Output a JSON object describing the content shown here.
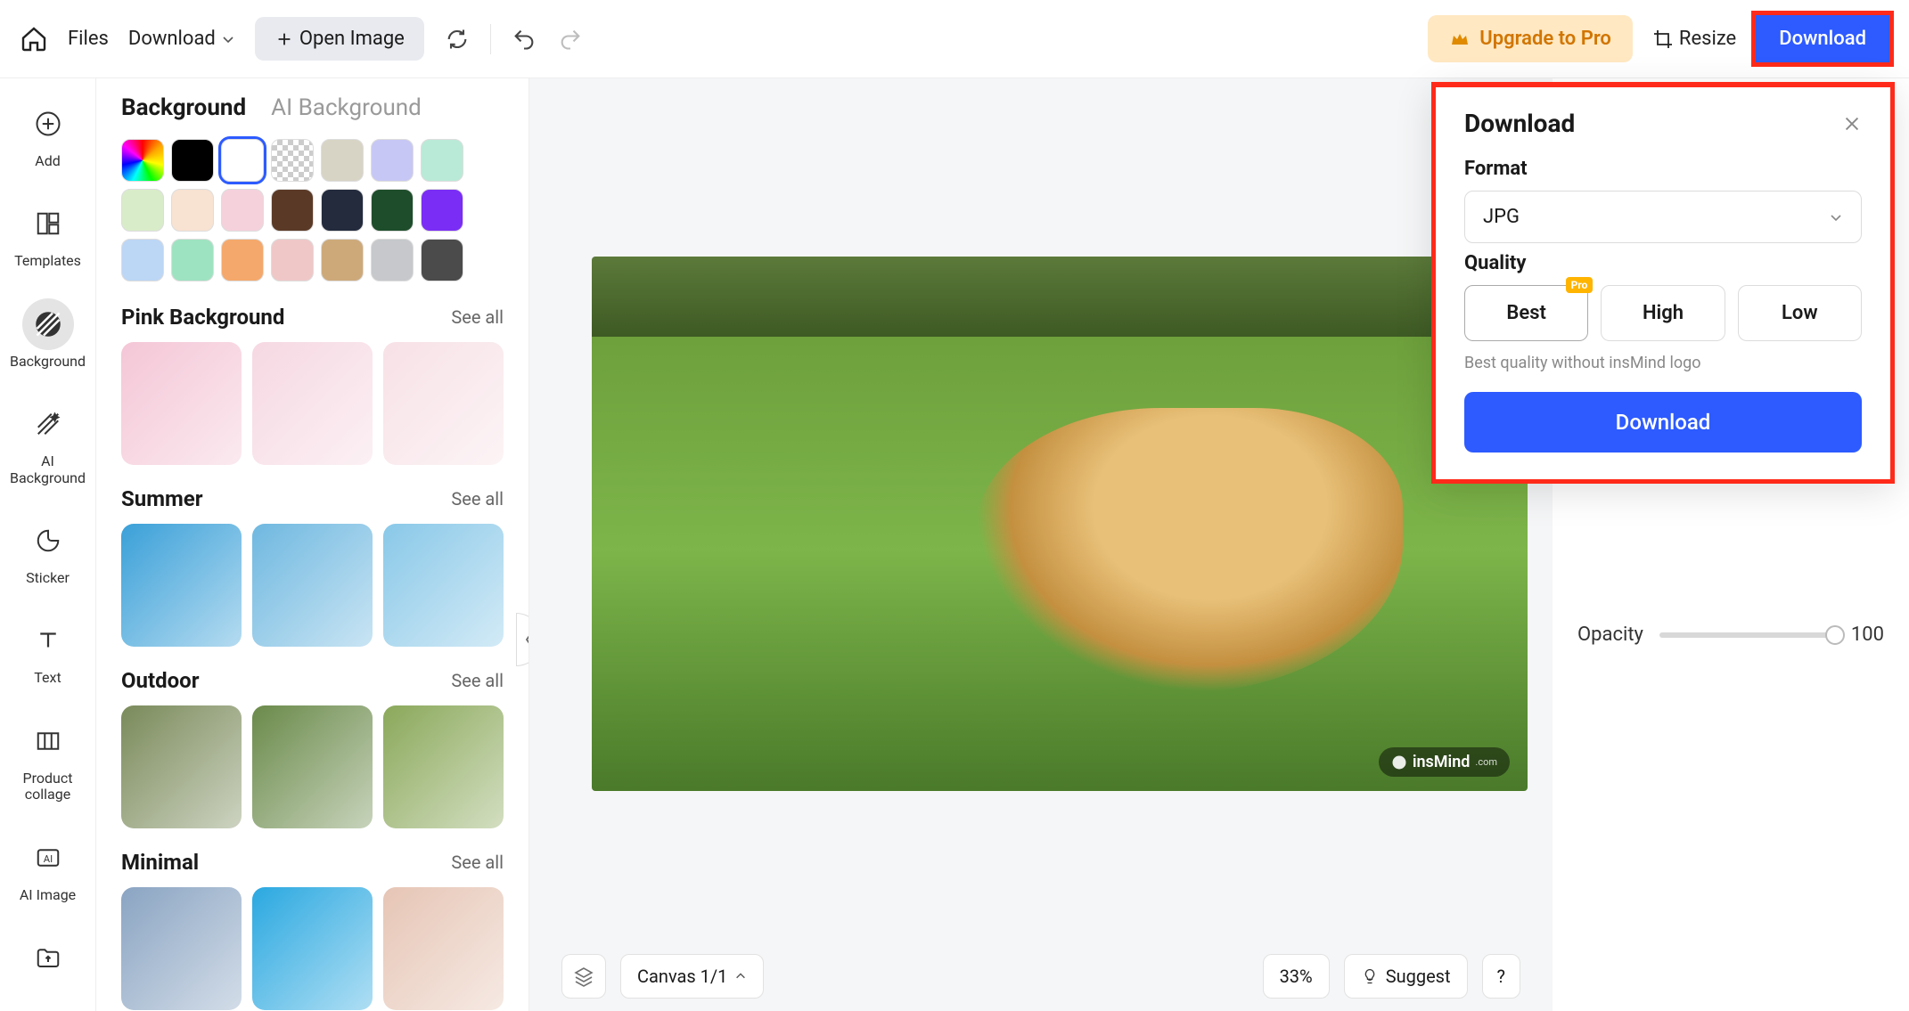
{
  "topbar": {
    "files": "Files",
    "download": "Download",
    "open_image": "Open Image",
    "upgrade": "Upgrade to Pro",
    "resize": "Resize",
    "download_btn": "Download"
  },
  "rail": {
    "add": "Add",
    "templates": "Templates",
    "background": "Background",
    "ai_background": "AI\nBackground",
    "sticker": "Sticker",
    "text": "Text",
    "product_collage": "Product\ncollage",
    "ai_image": "AI Image"
  },
  "panel": {
    "tab_background": "Background",
    "tab_ai_background": "AI Background",
    "swatches": [
      {
        "name": "rainbow",
        "css": "rainbow"
      },
      {
        "name": "black",
        "color": "#000000"
      },
      {
        "name": "white",
        "color": "#ffffff",
        "selected": true
      },
      {
        "name": "transparent",
        "css": "checker"
      },
      {
        "name": "gray-tan",
        "color": "#d7d4c5"
      },
      {
        "name": "lavender",
        "color": "#c7c7f5"
      },
      {
        "name": "mint",
        "color": "#b9ead7"
      },
      {
        "name": "pale-green",
        "color": "#d8ecc9"
      },
      {
        "name": "peach",
        "color": "#f8e2d2"
      },
      {
        "name": "pink",
        "color": "#f5d1dc"
      },
      {
        "name": "brown",
        "color": "#5a3a27"
      },
      {
        "name": "navy",
        "color": "#232b3d"
      },
      {
        "name": "forest",
        "color": "#1e4d2b"
      },
      {
        "name": "purple",
        "color": "#7a2df5"
      },
      {
        "name": "sky-grad",
        "color": "#bcd6f5"
      },
      {
        "name": "seafoam",
        "color": "#9ee3c1"
      },
      {
        "name": "orange",
        "color": "#f5a86b"
      },
      {
        "name": "blush",
        "color": "#f0c7c7"
      },
      {
        "name": "tan",
        "color": "#cda97a"
      },
      {
        "name": "silver",
        "color": "#c6c8cb"
      },
      {
        "name": "charcoal",
        "color": "#4b4b4b"
      }
    ],
    "categories": [
      {
        "key": "pink",
        "title": "Pink Background",
        "see_all": "See all",
        "thumbs": [
          "#f4c6d6",
          "#f6d8e2",
          "#f7e1e6"
        ]
      },
      {
        "key": "summer",
        "title": "Summer",
        "see_all": "See all",
        "thumbs": [
          "#3aa0d8",
          "#6fb8e0",
          "#89c8e8"
        ]
      },
      {
        "key": "outdoor",
        "title": "Outdoor",
        "see_all": "See all",
        "thumbs": [
          "#7a8a5a",
          "#6a8a4a",
          "#8aa85a"
        ]
      },
      {
        "key": "minimal",
        "title": "Minimal",
        "see_all": "See all",
        "thumbs": [
          "#8aa4c2",
          "#2aa8e0",
          "#e6c5b5"
        ]
      }
    ]
  },
  "canvas": {
    "watermark": "insMind",
    "watermark_suffix": ".com",
    "footer": {
      "canvas_label": "Canvas 1/1",
      "zoom": "33%",
      "suggest": "Suggest",
      "help": "?"
    }
  },
  "right": {
    "opacity_label": "Opacity",
    "opacity_value": "100"
  },
  "download_panel": {
    "title": "Download",
    "format_label": "Format",
    "format_value": "JPG",
    "quality_label": "Quality",
    "quality_options": [
      "Best",
      "High",
      "Low"
    ],
    "quality_selected": "Best",
    "pro_badge": "Pro",
    "quality_note": "Best quality without insMind logo",
    "download_btn": "Download"
  }
}
